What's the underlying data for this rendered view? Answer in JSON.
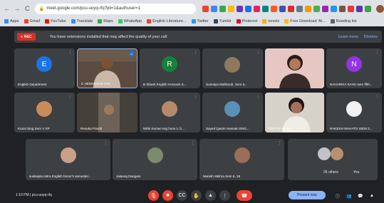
{
  "browser": {
    "url": "meet.google.com/pcu-uoyq-rfq?pli=1&authuser=1",
    "nav_back_icon": "←",
    "nav_forward_icon": "→",
    "nav_reload_icon": "C"
  },
  "bookmarks": [
    {
      "label": "Apps",
      "color": "#4285f4"
    },
    {
      "label": "Gmail",
      "color": "#ea4335"
    },
    {
      "label": "YouTube",
      "color": "#ff0000"
    },
    {
      "label": "Translate",
      "color": "#4285f4"
    },
    {
      "label": "Maps",
      "color": "#34a853"
    },
    {
      "label": "WhatsApp",
      "color": "#25d366"
    },
    {
      "label": "English Literature...",
      "color": "#ea4335"
    },
    {
      "label": "Twitter",
      "color": "#1da1f2"
    },
    {
      "label": "Tumblr",
      "color": "#35465c"
    },
    {
      "label": "Pinterest",
      "color": "#e60023"
    },
    {
      "label": "novels",
      "color": "#f4b400"
    },
    {
      "label": "Free Download 'Al...",
      "color": "#fbbc05"
    },
    {
      "label": "Reading list",
      "color": "#5f6368"
    }
  ],
  "banner": {
    "rec_label": "REC",
    "message": "You have extensions installed that may affect the quality of your call",
    "learn_more": "Learn more",
    "dismiss": "Dismiss"
  },
  "participants": [
    {
      "name": "English Department",
      "initial": "E",
      "color": "#1a73e8"
    },
    {
      "name": "C HEMANAND JHA",
      "initial": "",
      "color": ""
    },
    {
      "name": "B Shanti English Honours S...",
      "initial": "R",
      "color": "#188038"
    },
    {
      "name": "Sumaiya Mahboob, Sem 5...",
      "initial": "",
      "color": ""
    },
    {
      "name": "",
      "initial": "",
      "color": ""
    },
    {
      "name": "NAHARIKA SAHU sem fifth...",
      "initial": "N",
      "color": "#9334e6"
    },
    {
      "name": "Kunal Sing Sem V SP",
      "initial": "",
      "color": ""
    },
    {
      "name": "Renuka Pandit",
      "initial": "",
      "color": ""
    },
    {
      "name": "Nikhi Kumar eng hons 1 /1...",
      "initial": "",
      "color": ""
    },
    {
      "name": "Sayed Qasim Hasnain ENG...",
      "initial": "",
      "color": ""
    },
    {
      "name": "MUHAR SENGU",
      "initial": "",
      "color": ""
    },
    {
      "name": "RAKESH MAHATO ISEM 3...",
      "initial": "",
      "color": ""
    },
    {
      "name": "sudeepta mitra English honor's semester...",
      "initial": "",
      "color": ""
    },
    {
      "name": "Jaisaraj Dangam",
      "initial": "",
      "color": ""
    },
    {
      "name": "Manish Mishra Sem 5, 18",
      "initial": "",
      "color": ""
    }
  ],
  "others": {
    "label": "26 others",
    "count_badge": "You"
  },
  "bottom": {
    "time": "1:10 PM",
    "meeting_code": "pcu-uoyq-rfq",
    "present_label": "Present now"
  }
}
